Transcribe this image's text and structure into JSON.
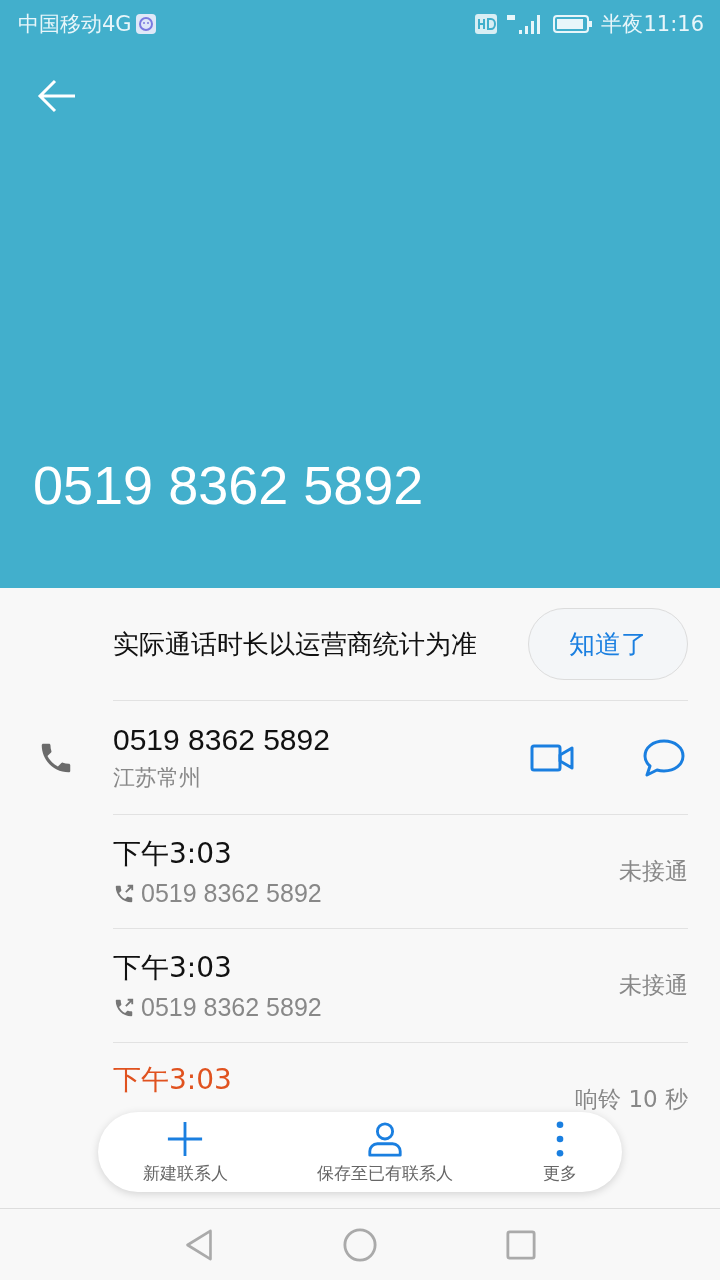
{
  "status_bar": {
    "carrier": "中国移动4G",
    "time": "半夜11:16"
  },
  "header": {
    "number": "0519 8362 5892"
  },
  "notice": {
    "text": "实际通话时长以运营商统计为准",
    "button": "知道了"
  },
  "contact": {
    "number": "0519 8362 5892",
    "location": "江苏常州"
  },
  "calls": [
    {
      "kind": "outgoing",
      "time": "下午3:03",
      "number": "0519 8362 5892",
      "result": "未接通"
    },
    {
      "kind": "outgoing",
      "time": "下午3:03",
      "number": "0519 8362 5892",
      "result": "未接通"
    },
    {
      "kind": "missed",
      "time": "下午3:03",
      "result": "响铃 10 秒"
    }
  ],
  "actions": [
    {
      "kind": "add",
      "label": "新建联系人"
    },
    {
      "kind": "person",
      "label": "保存至已有联系人"
    },
    {
      "kind": "more",
      "label": "更多"
    }
  ]
}
